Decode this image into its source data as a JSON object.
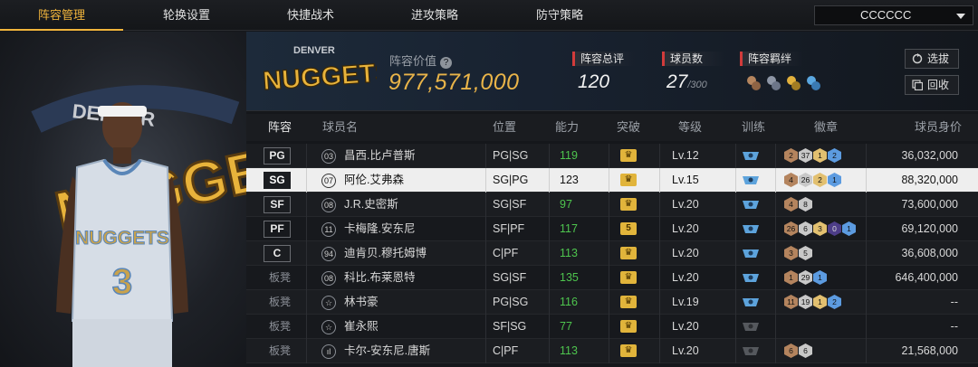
{
  "nav": {
    "tabs": [
      {
        "label": "阵容管理",
        "active": true
      },
      {
        "label": "轮换设置",
        "active": false
      },
      {
        "label": "快捷战术",
        "active": false
      },
      {
        "label": "进攻策略",
        "active": false
      },
      {
        "label": "防守策略",
        "active": false
      }
    ],
    "dropdown_value": "CCCCCC"
  },
  "header": {
    "team_logo_text": "NUGGETS",
    "team_logo_arc": "DENVER",
    "value_label": "阵容价值",
    "value": "977,571,000",
    "overall_label": "阵容总评",
    "overall": "120",
    "count_label": "球员数",
    "count": "27",
    "count_max": "/300",
    "bond_label": "阵容羁绊",
    "select_button": "选拔",
    "recycle_button": "回收"
  },
  "player_art": {
    "logo_text": "NUGGETS",
    "logo_arc": "DENVER",
    "jersey_text": "NUGGETS",
    "jersey_number": "3"
  },
  "table": {
    "headers": [
      "阵容",
      "球员名",
      "位置",
      "能力",
      "突破",
      "等级",
      "训练",
      "徽章",
      "球员身价"
    ],
    "rows": [
      {
        "slot": "PG",
        "starter": true,
        "num": "03",
        "name": "昌西.比卢普斯",
        "pos": "PG|SG",
        "ability": "119",
        "ability_green": true,
        "break": "crown",
        "level": "Lv.12",
        "train": "blue",
        "badges": [
          [
            "b-bronze",
            "2"
          ],
          [
            "b-silver",
            "37"
          ],
          [
            "b-gold",
            "1"
          ],
          [
            "b-blue",
            "2"
          ]
        ],
        "price": "36,032,000"
      },
      {
        "slot": "SG",
        "starter": true,
        "num": "07",
        "name": "阿伦.艾弗森",
        "pos": "SG|PG",
        "ability": "123",
        "ability_green": false,
        "break": "crown",
        "level": "Lv.15",
        "train": "blue",
        "badges": [
          [
            "b-bronze",
            "4"
          ],
          [
            "b-silver",
            "26"
          ],
          [
            "b-gold",
            "2"
          ],
          [
            "b-blue",
            "1"
          ]
        ],
        "price": "88,320,000",
        "selected": true
      },
      {
        "slot": "SF",
        "starter": true,
        "num": "08",
        "name": "J.R.史密斯",
        "pos": "SG|SF",
        "ability": "97",
        "ability_green": true,
        "break": "crown",
        "level": "Lv.20",
        "train": "blue",
        "badges": [
          [
            "b-bronze",
            "4"
          ],
          [
            "b-silver",
            "8"
          ]
        ],
        "price": "73,600,000"
      },
      {
        "slot": "PF",
        "starter": true,
        "num": "11",
        "name": "卡梅隆.安东尼",
        "pos": "SF|PF",
        "ability": "117",
        "ability_green": true,
        "break": "5",
        "level": "Lv.20",
        "train": "blue",
        "badges": [
          [
            "b-bronze",
            "26"
          ],
          [
            "b-silver",
            "6"
          ],
          [
            "b-gold",
            "3"
          ],
          [
            "b-purple",
            "0"
          ],
          [
            "b-blue",
            "1"
          ]
        ],
        "price": "69,120,000"
      },
      {
        "slot": "C",
        "starter": true,
        "num": "94",
        "name": "迪肯贝.穆托姆博",
        "pos": "C|PF",
        "ability": "113",
        "ability_green": true,
        "break": "crown",
        "level": "Lv.20",
        "train": "blue",
        "badges": [
          [
            "b-bronze",
            "3"
          ],
          [
            "b-silver",
            "5"
          ]
        ],
        "price": "36,608,000"
      },
      {
        "slot": "板凳",
        "starter": false,
        "num": "08",
        "name": "科比.布莱恩特",
        "pos": "SG|SF",
        "ability": "135",
        "ability_green": true,
        "break": "crown",
        "level": "Lv.20",
        "train": "blue",
        "badges": [
          [
            "b-bronze",
            "1"
          ],
          [
            "b-silver",
            "29"
          ],
          [
            "b-blue",
            "1"
          ]
        ],
        "price": "646,400,000"
      },
      {
        "slot": "板凳",
        "starter": false,
        "num": "☆",
        "name": "林书豪",
        "pos": "PG|SG",
        "ability": "116",
        "ability_green": true,
        "break": "crown",
        "level": "Lv.19",
        "train": "blue",
        "badges": [
          [
            "b-bronze",
            "11"
          ],
          [
            "b-silver",
            "19"
          ],
          [
            "b-gold",
            "1"
          ],
          [
            "b-blue",
            "2"
          ]
        ],
        "price": "--"
      },
      {
        "slot": "板凳",
        "starter": false,
        "num": "☆",
        "name": "崔永熙",
        "pos": "SF|SG",
        "ability": "77",
        "ability_green": true,
        "break": "crown",
        "level": "Lv.20",
        "train": "gray",
        "badges": [],
        "price": "--"
      },
      {
        "slot": "板凳",
        "starter": false,
        "num": "ıl",
        "name": "卡尔-安东尼.唐斯",
        "pos": "C|PF",
        "ability": "113",
        "ability_green": true,
        "break": "crown",
        "level": "Lv.20",
        "train": "gray",
        "badges": [
          [
            "b-bronze",
            "6"
          ],
          [
            "b-silver",
            "6"
          ]
        ],
        "price": "21,568,000"
      }
    ]
  }
}
